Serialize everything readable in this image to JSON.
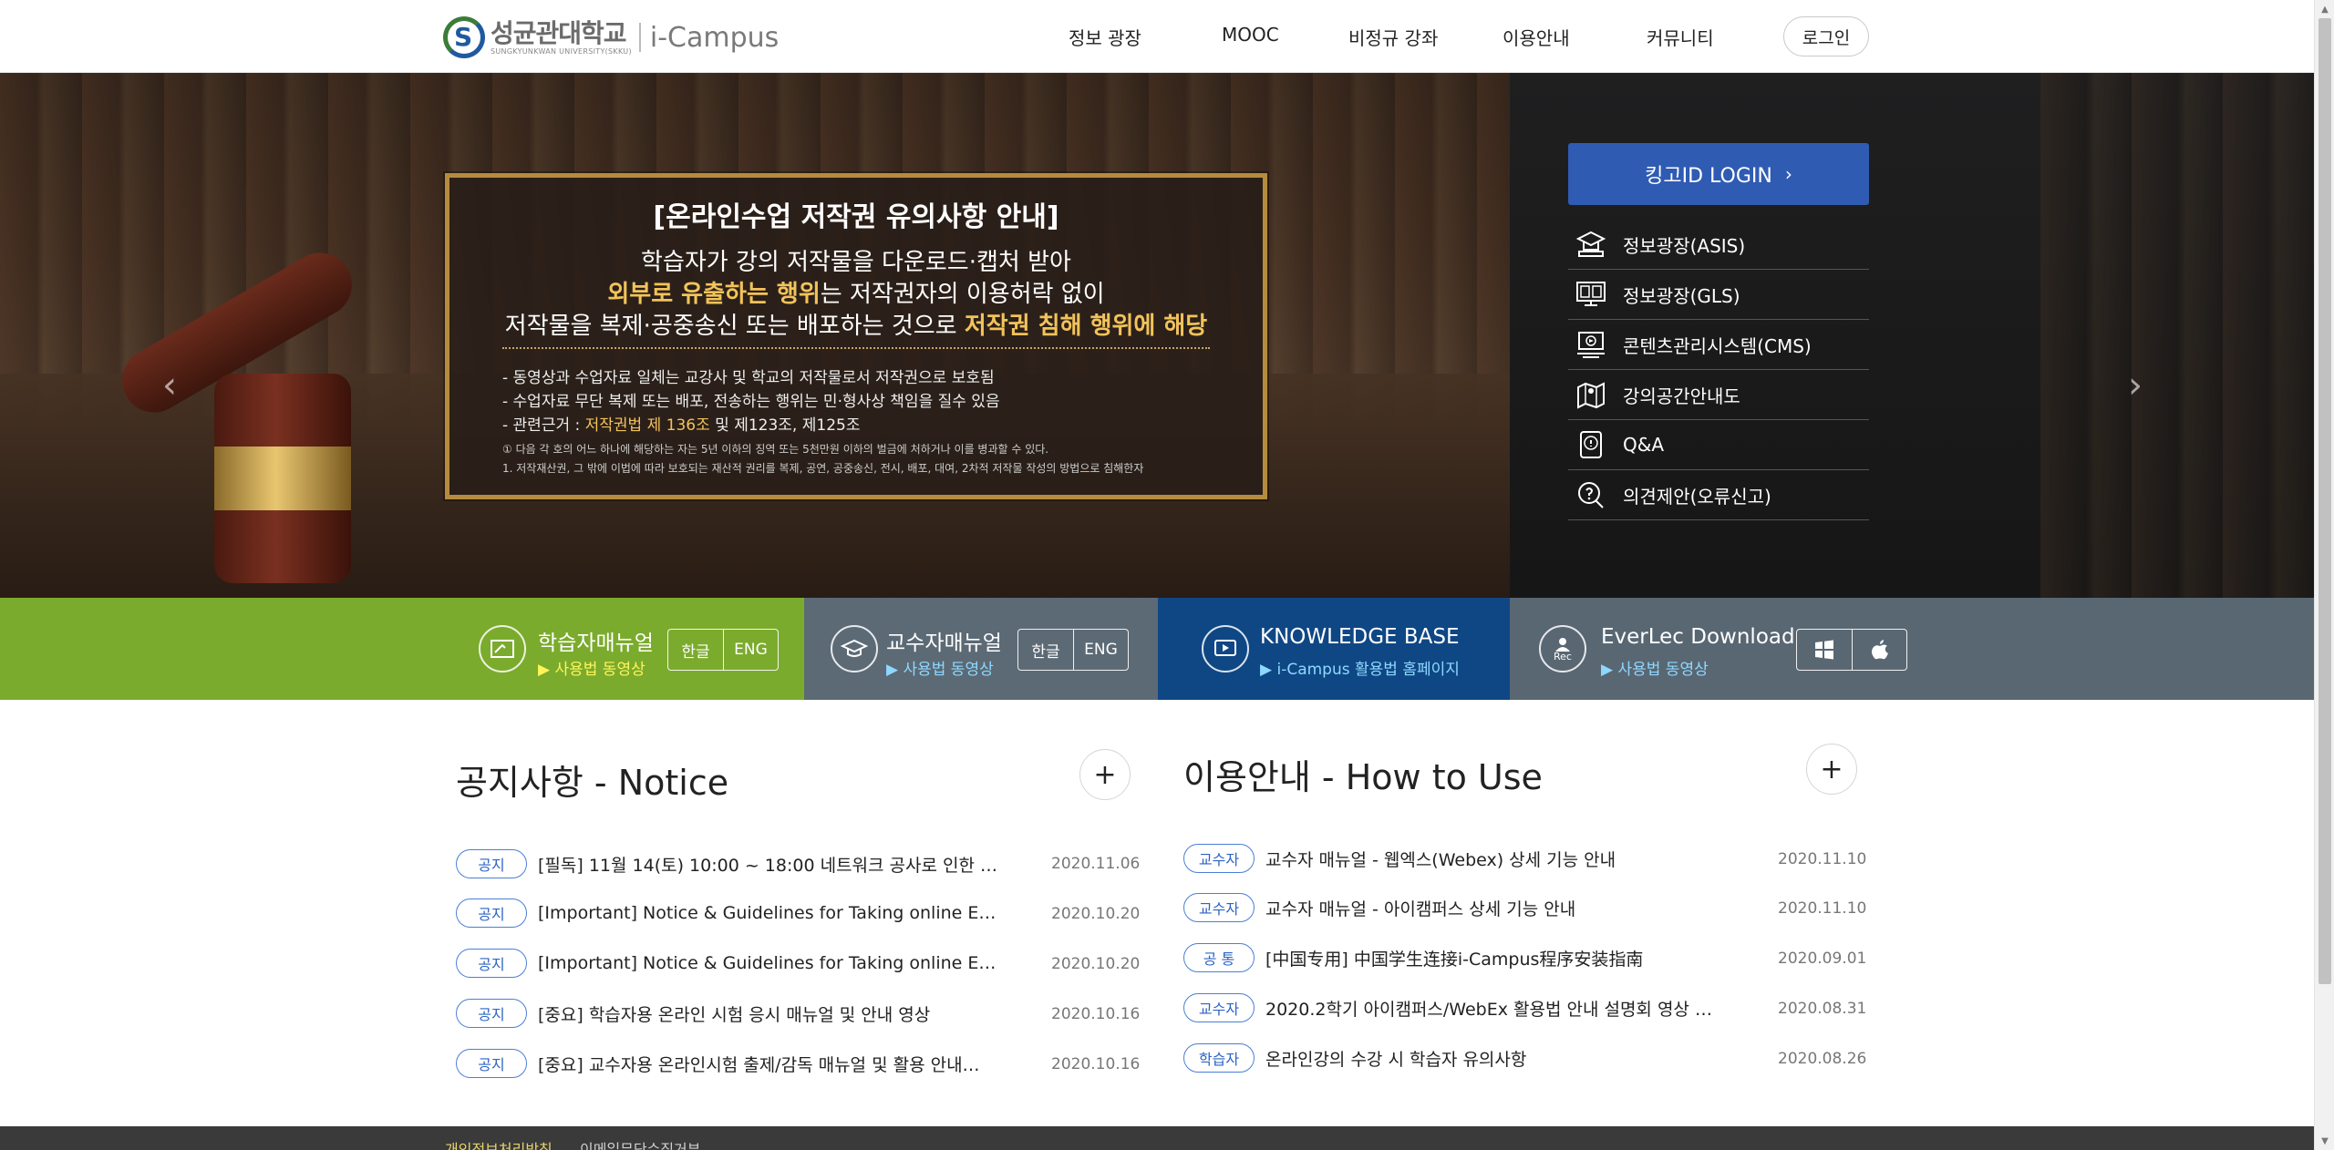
{
  "header": {
    "logo_korean": "성균관대학교",
    "logo_english": "SUNGKYUNKWAN UNIVERSITY(SKKU)",
    "logo_campus": "i-Campus",
    "nav": [
      "정보 광장",
      "MOOC",
      "비정규 강좌",
      "이용안내",
      "커뮤니티"
    ],
    "login_label": "로그인"
  },
  "hero": {
    "title": "[온라인수업 저작권 유의사항 안내]",
    "line1": "학습자가 강의 저작물을 다운로드·캡처 받아",
    "line2_hl": "외부로 유출하는 행위",
    "line2_rest": "는 저작권자의 이용허락 없이",
    "line3_a": "저작물을 복제·공중송신 또는 배포하는 것으로 ",
    "line3_hl": "저작권 침해 행위에 해당",
    "bullet1": "- 동영상과 수업자료 일체는 교강사 및 학교의 저작물로서 저작권으로 보호됨",
    "bullet2": "- 수업자료 무단 복제 또는 배포, 전송하는 행위는 민·형사상 책임을 질수 있음",
    "bullet3_a": "- 관련근거 : ",
    "bullet3_hl": "저작권법 제 136조",
    "bullet3_b": " 및 제123조, 제125조",
    "small1": "① 다음 각 호의 어느 하나에 해당하는 자는 5년 이하의 징역 또는 5천만원 이하의 벌금에 처하거나 이를 병과할 수 있다.",
    "small2": "1. 저작재산권, 그 밖에 이법에 따라 보호되는 재산적 권리를 복제, 공연, 공중송신, 전시, 배포, 대여, 2차적 저작물 작성의 방법으로 침해한자",
    "prev_arrow": "‹",
    "next_arrow": "›"
  },
  "login_panel": {
    "kingo_label": "킹고ID LOGIN",
    "kingo_chevron": "›",
    "quick_links": [
      {
        "label": "정보광장(ASIS)",
        "icon": "asis-icon"
      },
      {
        "label": "정보광장(GLS)",
        "icon": "gls-icon"
      },
      {
        "label": "콘텐츠관리시스템(CMS)",
        "icon": "cms-icon"
      },
      {
        "label": "강의공간안내도",
        "icon": "map-icon"
      },
      {
        "label": "Q&A",
        "icon": "qna-icon"
      },
      {
        "label": "의견제안(오류신고)",
        "icon": "suggest-icon"
      }
    ]
  },
  "manuals": {
    "student": {
      "title": "학습자매뉴얼",
      "sub": "▶ 사용법 동영상",
      "btn_ko": "한글",
      "btn_en": "ENG"
    },
    "teacher": {
      "title": "교수자매뉴얼",
      "sub": "▶ 사용법 동영상",
      "btn_ko": "한글",
      "btn_en": "ENG"
    },
    "kb": {
      "title": "KNOWLEDGE BASE",
      "sub": "▶ i-Campus 활용법 홈페이지"
    },
    "everlec": {
      "title": "EverLec Download",
      "sub": "▶ 사용법 동영상",
      "rec_label": "Rec"
    }
  },
  "notice": {
    "title": "공지사항 - Notice",
    "more": "+",
    "items": [
      {
        "tag": "공지",
        "text": "[필독] 11월 14(토) 10:00 ~ 18:00 네트워크 공사로 인한 …",
        "date": "2020.11.06"
      },
      {
        "tag": "공지",
        "text": "[Important] Notice & Guidelines for Taking online Ex…",
        "date": "2020.10.20"
      },
      {
        "tag": "공지",
        "text": "[Important] Notice & Guidelines for Taking online Ex…",
        "date": "2020.10.20"
      },
      {
        "tag": "공지",
        "text": "[중요] 학습자용 온라인 시험 응시 매뉴얼 및 안내 영상",
        "date": "2020.10.16"
      },
      {
        "tag": "공지",
        "text": "[중요] 교수자용 온라인시험 출제/감독 매뉴얼 및 활용 안내…",
        "date": "2020.10.16"
      }
    ]
  },
  "howto": {
    "title": "이용안내 - How to Use",
    "more": "+",
    "items": [
      {
        "tag": "교수자",
        "text": "교수자 매뉴얼 - 웹엑스(Webex) 상세 기능 안내",
        "date": "2020.11.10"
      },
      {
        "tag": "교수자",
        "text": "교수자 매뉴얼 - 아이캠퍼스 상세 기능 안내",
        "date": "2020.11.10"
      },
      {
        "tag": "공 통",
        "text": "[中国专用] 中国学生连接i-Campus程序安装指南",
        "date": "2020.09.01"
      },
      {
        "tag": "교수자",
        "text": "2020.2학기 아이캠퍼스/WebEx 활용법 안내 설명회 영상 …",
        "date": "2020.08.31"
      },
      {
        "tag": "학습자",
        "text": "온라인강의 수강 시 학습자 유의사항",
        "date": "2020.08.26"
      }
    ]
  },
  "footer": {
    "privacy": "개인정보처리방침",
    "email_policy": "이메일무단수집거부"
  },
  "colors": {
    "student_band": "#7bab2d",
    "teacher_band": "#5c6a75",
    "kb_band": "#0f4785",
    "everlec_band": "#596773",
    "kingo_button": "#2f5bb3",
    "tag_blue": "#2d64c4",
    "highlight_gold": "#f2c35a"
  }
}
